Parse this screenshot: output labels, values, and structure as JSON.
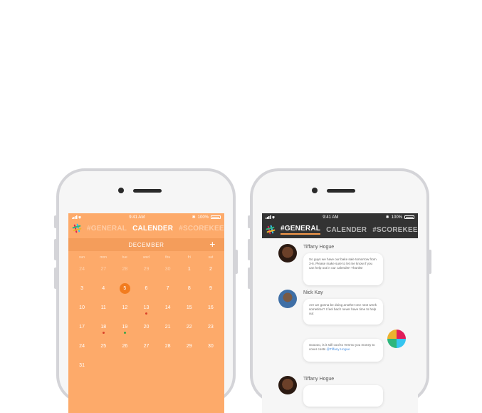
{
  "left_phone": {
    "status": {
      "time": "9:41 AM",
      "battery": "100%"
    },
    "tabs": [
      "#GENERAL",
      "CALENDER",
      "#SCOREKEEPING"
    ],
    "active_tab": 1,
    "month": "DECEMBER",
    "add_label": "+",
    "weekdays": [
      "sun",
      "mon",
      "tue",
      "wed",
      "thu",
      "fri",
      "sat"
    ],
    "days": [
      {
        "n": "24",
        "faded": true
      },
      {
        "n": "27",
        "faded": true
      },
      {
        "n": "28",
        "faded": true
      },
      {
        "n": "29",
        "faded": true
      },
      {
        "n": "30",
        "faded": true
      },
      {
        "n": "1"
      },
      {
        "n": "2"
      },
      {
        "n": "3"
      },
      {
        "n": "4"
      },
      {
        "n": "5",
        "today": true
      },
      {
        "n": "6"
      },
      {
        "n": "7"
      },
      {
        "n": "8"
      },
      {
        "n": "9"
      },
      {
        "n": "10"
      },
      {
        "n": "11"
      },
      {
        "n": "12"
      },
      {
        "n": "13",
        "dot": "#d9432b"
      },
      {
        "n": "14"
      },
      {
        "n": "15"
      },
      {
        "n": "16"
      },
      {
        "n": "17"
      },
      {
        "n": "18",
        "dot": "#d9432b"
      },
      {
        "n": "19",
        "dot": "#3da34a"
      },
      {
        "n": "20"
      },
      {
        "n": "21"
      },
      {
        "n": "22"
      },
      {
        "n": "23"
      },
      {
        "n": "24"
      },
      {
        "n": "25"
      },
      {
        "n": "26"
      },
      {
        "n": "27"
      },
      {
        "n": "28"
      },
      {
        "n": "29"
      },
      {
        "n": "30"
      },
      {
        "n": "31"
      }
    ],
    "colors": {
      "background": "#fdaa6a",
      "month_bar": "#f49d5b",
      "today": "#f27c1f"
    }
  },
  "right_phone": {
    "status": {
      "time": "9:41 AM",
      "battery": "100%"
    },
    "tabs": [
      "#GENERAL",
      "CALENDER",
      "#SCOREKEEPING"
    ],
    "active_tab": 0,
    "messages": [
      {
        "name": "Tiffany Hogue",
        "text": "So guys we have our bake sale tomorrow from 3-6. Please make sure to let me know if you can help out in our calender! Thanks!"
      },
      {
        "name": "Nick Kay",
        "text": "Are we gonna be doing another one next week sometime? I feel bad I never have time to help out"
      },
      {
        "name": "",
        "text": "Sooooo, is it still cool to Venmo you money to cover costs ",
        "mention": "@Tiffany Hogue"
      },
      {
        "name": "Tiffany Hogue",
        "text": ""
      }
    ],
    "colors": {
      "header": "#333333",
      "accent": "#f79a4a",
      "mention": "#4a90e2"
    }
  }
}
